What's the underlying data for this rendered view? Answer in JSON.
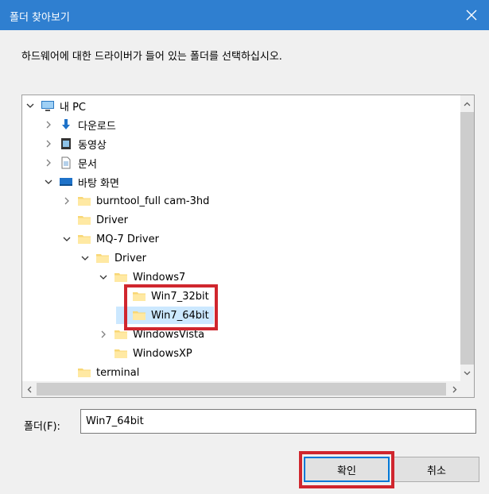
{
  "window": {
    "title": "폴더 찾아보기"
  },
  "instruction": "하드웨어에 대한 드라이버가 들어 있는 폴더를 선택하십시오.",
  "tree": [
    {
      "label": "내 PC",
      "icon": "pc-icon",
      "state": "expanded",
      "selected": false
    },
    {
      "label": "다운로드",
      "icon": "download-icon",
      "state": "collapsed",
      "selected": false
    },
    {
      "label": "동영상",
      "icon": "video-icon",
      "state": "collapsed",
      "selected": false
    },
    {
      "label": "문서",
      "icon": "document-icon",
      "state": "collapsed",
      "selected": false
    },
    {
      "label": "바탕 화면",
      "icon": "desktop-icon",
      "state": "expanded",
      "selected": false
    },
    {
      "label": "burntool_full cam-3hd",
      "icon": "folder-icon",
      "state": "collapsed",
      "selected": false
    },
    {
      "label": "Driver",
      "icon": "folder-icon",
      "state": "none",
      "selected": false
    },
    {
      "label": "MQ-7 Driver",
      "icon": "folder-icon",
      "state": "expanded",
      "selected": false
    },
    {
      "label": "Driver",
      "icon": "folder-icon",
      "state": "expanded",
      "selected": false
    },
    {
      "label": "Windows7",
      "icon": "folder-icon",
      "state": "expanded",
      "selected": false
    },
    {
      "label": "Win7_32bit",
      "icon": "folder-icon",
      "state": "none",
      "selected": false
    },
    {
      "label": "Win7_64bit",
      "icon": "folder-icon",
      "state": "none",
      "selected": true
    },
    {
      "label": "WindowsVista",
      "icon": "folder-icon",
      "state": "collapsed",
      "selected": false
    },
    {
      "label": "WindowsXP",
      "icon": "folder-icon",
      "state": "none",
      "selected": false
    },
    {
      "label": "terminal",
      "icon": "folder-icon",
      "state": "none",
      "selected": false
    }
  ],
  "folder_field": {
    "label": "폴더(F):",
    "value": "Win7_64bit"
  },
  "buttons": {
    "ok": "확인",
    "cancel": "취소"
  },
  "colors": {
    "titlebar": "#2f7fd0",
    "selection": "#cce8ff",
    "highlight": "#d0262e"
  }
}
